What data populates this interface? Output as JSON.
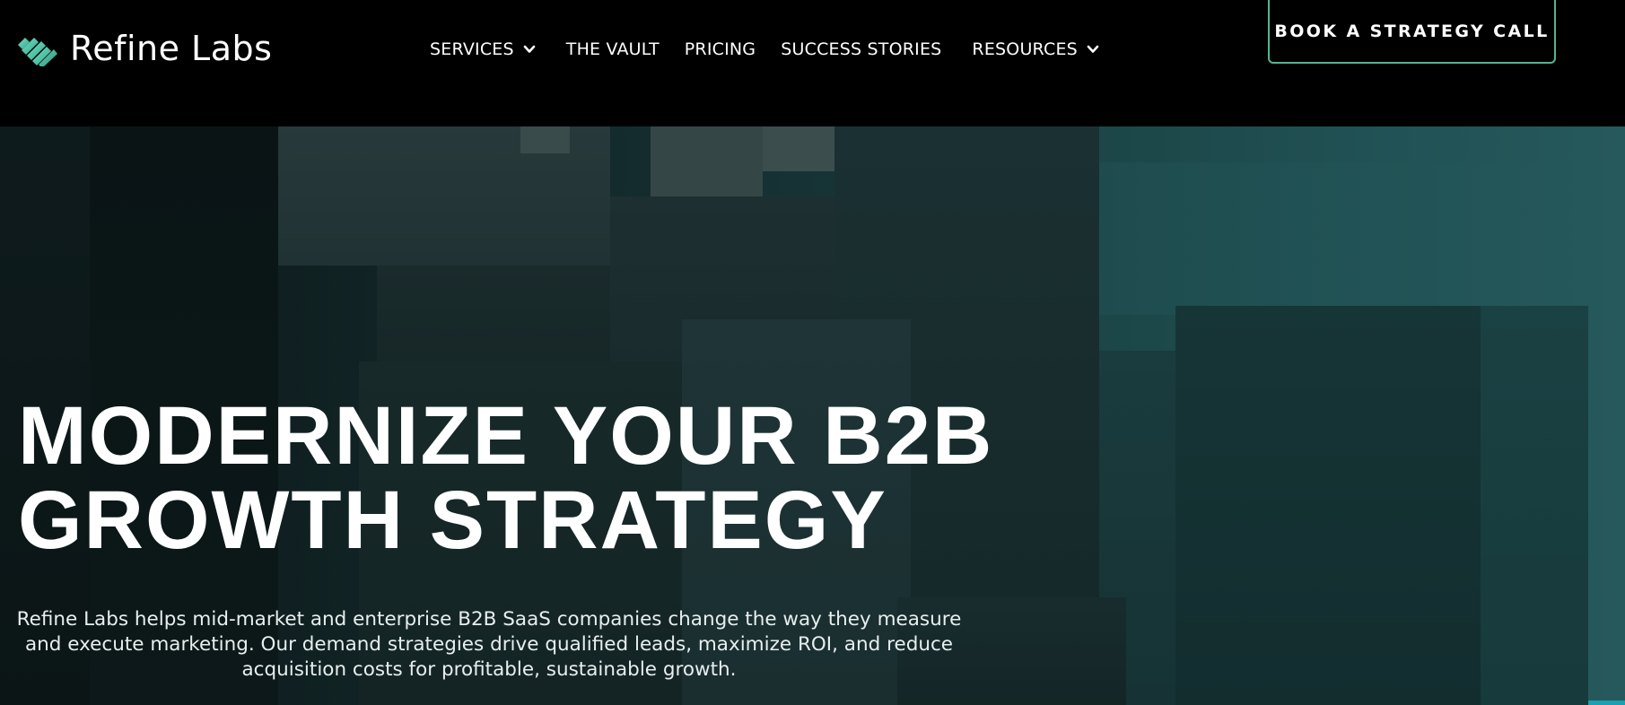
{
  "brand": {
    "name": "Refine Labs",
    "logo_icon": "diagonal-stripes-logo-mark",
    "accent_color": "#4fb694"
  },
  "nav": {
    "items": [
      {
        "label": "SERVICES",
        "has_dropdown": true
      },
      {
        "label": "THE VAULT",
        "has_dropdown": false
      },
      {
        "label": "PRICING",
        "has_dropdown": false
      },
      {
        "label": "SUCCESS STORIES",
        "has_dropdown": false
      },
      {
        "label": "RESOURCES",
        "has_dropdown": true
      }
    ]
  },
  "cta": {
    "label": "BOOK A STRATEGY CALL"
  },
  "hero": {
    "title_line_1": "MODERNIZE YOUR B2B",
    "title_line_2": "GROWTH STRATEGY",
    "description": "Refine Labs helps mid-market and enterprise B2B SaaS companies change the way they measure and execute marketing. Our demand strategies drive qualified leads, maximize ROI, and reduce acquisition costs for profitable, sustainable growth."
  }
}
